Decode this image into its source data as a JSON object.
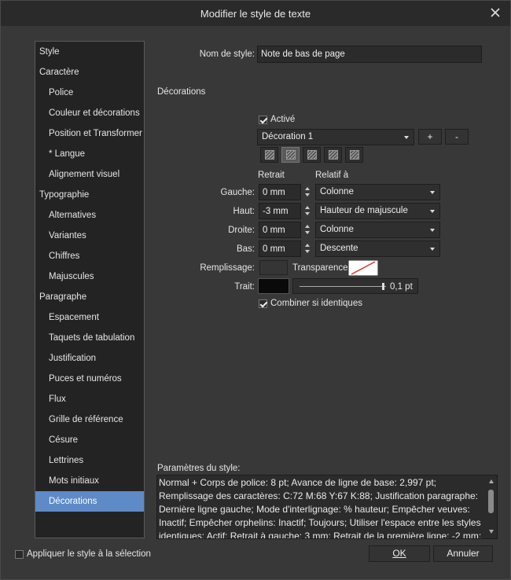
{
  "title": "Modifier le style de texte",
  "sidebar": {
    "items": [
      {
        "label": "Style",
        "kind": "sec"
      },
      {
        "label": "Caractère",
        "kind": "sec"
      },
      {
        "label": "Police",
        "kind": "sub"
      },
      {
        "label": "Couleur et décorations",
        "kind": "sub"
      },
      {
        "label": "Position et Transformer",
        "kind": "sub"
      },
      {
        "label": "* Langue",
        "kind": "sub"
      },
      {
        "label": "Alignement visuel",
        "kind": "sub"
      },
      {
        "label": "Typographie",
        "kind": "sec"
      },
      {
        "label": "Alternatives",
        "kind": "sub"
      },
      {
        "label": "Variantes",
        "kind": "sub"
      },
      {
        "label": "Chiffres",
        "kind": "sub"
      },
      {
        "label": "Majuscules",
        "kind": "sub"
      },
      {
        "label": "Paragraphe",
        "kind": "sec"
      },
      {
        "label": "Espacement",
        "kind": "sub"
      },
      {
        "label": "Taquets de tabulation",
        "kind": "sub"
      },
      {
        "label": "Justification",
        "kind": "sub"
      },
      {
        "label": "Puces et numéros",
        "kind": "sub"
      },
      {
        "label": "Flux",
        "kind": "sub"
      },
      {
        "label": "Grille de référence",
        "kind": "sub"
      },
      {
        "label": "Césure",
        "kind": "sub"
      },
      {
        "label": "Lettrines",
        "kind": "sub"
      },
      {
        "label": "Mots initiaux",
        "kind": "sub"
      },
      {
        "label": "Décorations",
        "kind": "sub",
        "selected": true
      }
    ]
  },
  "style_name": {
    "label": "Nom de style:",
    "value": "Note de bas de page"
  },
  "decorations": {
    "heading": "Décorations",
    "active": {
      "label": "Activé",
      "checked": true
    },
    "decoration_select": "Décoration 1",
    "add_label": "+",
    "remove_label": "-",
    "col_retrait": "Retrait",
    "col_relatif": "Relatif à",
    "rows": [
      {
        "label": "Gauche:",
        "value": "0 mm",
        "relative": "Colonne"
      },
      {
        "label": "Haut:",
        "value": "-3 mm",
        "relative": "Hauteur de majuscule"
      },
      {
        "label": "Droite:",
        "value": "0 mm",
        "relative": "Colonne"
      },
      {
        "label": "Bas:",
        "value": "0 mm",
        "relative": "Descente"
      }
    ],
    "fill_label": "Remplissage:",
    "transparency_label": "Transparence:",
    "stroke_label": "Trait:",
    "stroke_width": "0,1 pt",
    "stroke_slider_fraction": 0.95,
    "combine": {
      "label": "Combiner si identiques",
      "checked": true
    },
    "colors": {
      "fill": "#353535",
      "stroke": "#0a0a0a",
      "transparency_bg": "#ffffff",
      "transparency_slash": "#e0312b"
    }
  },
  "params": {
    "label": "Paramètres du style:",
    "text": "Normal + Corps de police: 8 pt; Avance de ligne de base: 2,997 pt; Remplissage des caractères: C:72 M:68 Y:67 K:88; Justification paragraphe: Dernière ligne gauche; Mode d'interlignage: % hauteur; Empêcher veuves: Inactif; Empêcher orphelins: Inactif; Toujours; Utiliser l'espace entre les styles identiques: Actif; Retrait à gauche: 3 mm; Retrait de la première ligne: -2 mm;"
  },
  "footer": {
    "apply_label": "Appliquer le style à la sélection",
    "apply_checked": false,
    "ok_label": "OK",
    "cancel_label": "Annuler"
  },
  "theme": {
    "accent": "#5e8ac7"
  }
}
